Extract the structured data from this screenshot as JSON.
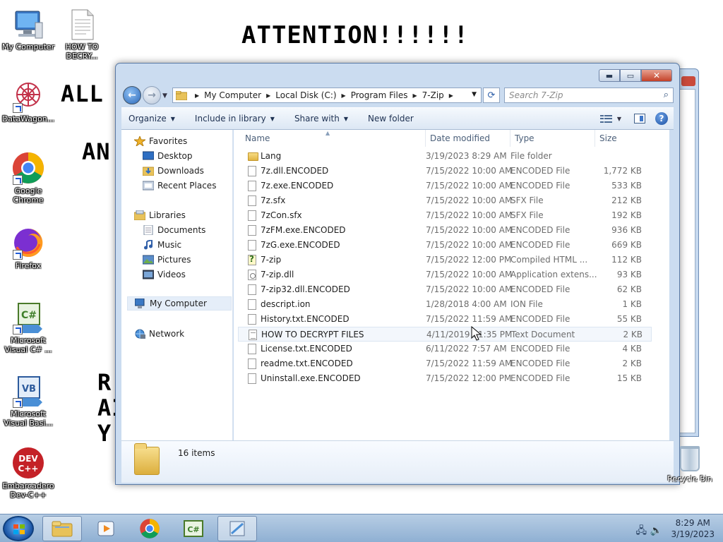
{
  "wallpaper": {
    "title": "ATTENTION!!!!!!",
    "line1": "ALL Y",
    "line2": "AN",
    "line3a": "R",
    "line3b": "AI",
    "line3c": "Y"
  },
  "desktop": {
    "icons": [
      {
        "label": "My Computer",
        "icon": "computer-icon"
      },
      {
        "label": "HOW TO DECRY...",
        "icon": "text-document-icon"
      },
      {
        "label": "DataWagon...",
        "icon": "datawagon-icon"
      },
      {
        "label": "Google Chrome",
        "icon": "chrome-icon"
      },
      {
        "label": "Firefox",
        "icon": "firefox-icon"
      },
      {
        "label": "Microsoft Visual C# ...",
        "icon": "visual-csharp-icon"
      },
      {
        "label": "Microsoft Visual Basi...",
        "icon": "visual-basic-icon"
      },
      {
        "label": "Embarcadero Dev-C++",
        "icon": "devcpp-icon"
      },
      {
        "label": "Recycle Bin",
        "icon": "recycle-bin-icon"
      }
    ]
  },
  "explorer": {
    "breadcrumb": [
      "My Computer",
      "Local Disk (C:)",
      "Program Files",
      "7-Zip"
    ],
    "search_placeholder": "Search 7-Zip",
    "toolbar": {
      "organize": "Organize",
      "include_in_library": "Include in library",
      "share_with": "Share with",
      "new_folder": "New folder"
    },
    "nav": {
      "favorites": "Favorites",
      "desktop": "Desktop",
      "downloads": "Downloads",
      "recent_places": "Recent Places",
      "libraries": "Libraries",
      "documents": "Documents",
      "music": "Music",
      "pictures": "Pictures",
      "videos": "Videos",
      "my_computer": "My Computer",
      "network": "Network"
    },
    "columns": {
      "name": "Name",
      "date": "Date modified",
      "type": "Type",
      "size": "Size"
    },
    "files": [
      {
        "name": "Lang",
        "date": "3/19/2023 8:29 AM",
        "type": "File folder",
        "size": ""
      },
      {
        "name": "7z.dll.ENCODED",
        "date": "7/15/2022 10:00 AM",
        "type": "ENCODED File",
        "size": "1,772 KB"
      },
      {
        "name": "7z.exe.ENCODED",
        "date": "7/15/2022 10:00 AM",
        "type": "ENCODED File",
        "size": "533 KB"
      },
      {
        "name": "7z.sfx",
        "date": "7/15/2022 10:00 AM",
        "type": "SFX File",
        "size": "212 KB"
      },
      {
        "name": "7zCon.sfx",
        "date": "7/15/2022 10:00 AM",
        "type": "SFX File",
        "size": "192 KB"
      },
      {
        "name": "7zFM.exe.ENCODED",
        "date": "7/15/2022 10:00 AM",
        "type": "ENCODED File",
        "size": "936 KB"
      },
      {
        "name": "7zG.exe.ENCODED",
        "date": "7/15/2022 10:00 AM",
        "type": "ENCODED File",
        "size": "669 KB"
      },
      {
        "name": "7-zip",
        "date": "7/15/2022 12:00 PM",
        "type": "Compiled HTML ...",
        "size": "112 KB"
      },
      {
        "name": "7-zip.dll",
        "date": "7/15/2022 10:00 AM",
        "type": "Application extens...",
        "size": "93 KB"
      },
      {
        "name": "7-zip32.dll.ENCODED",
        "date": "7/15/2022 10:00 AM",
        "type": "ENCODED File",
        "size": "62 KB"
      },
      {
        "name": "descript.ion",
        "date": "1/28/2018 4:00 AM",
        "type": "ION File",
        "size": "1 KB"
      },
      {
        "name": "History.txt.ENCODED",
        "date": "7/15/2022 11:59 AM",
        "type": "ENCODED File",
        "size": "55 KB"
      },
      {
        "name": "HOW TO DECRYPT FILES",
        "date": "4/11/2019 11:35 PM",
        "type": "Text Document",
        "size": "2 KB"
      },
      {
        "name": "License.txt.ENCODED",
        "date": "6/11/2022 7:57 AM",
        "type": "ENCODED File",
        "size": "4 KB"
      },
      {
        "name": "readme.txt.ENCODED",
        "date": "7/15/2022 11:59 AM",
        "type": "ENCODED File",
        "size": "2 KB"
      },
      {
        "name": "Uninstall.exe.ENCODED",
        "date": "7/15/2022 12:00 PM",
        "type": "ENCODED File",
        "size": "15 KB"
      }
    ],
    "item_count": "16 items"
  },
  "taskbar": {
    "time": "8:29 AM",
    "date": "3/19/2023"
  }
}
